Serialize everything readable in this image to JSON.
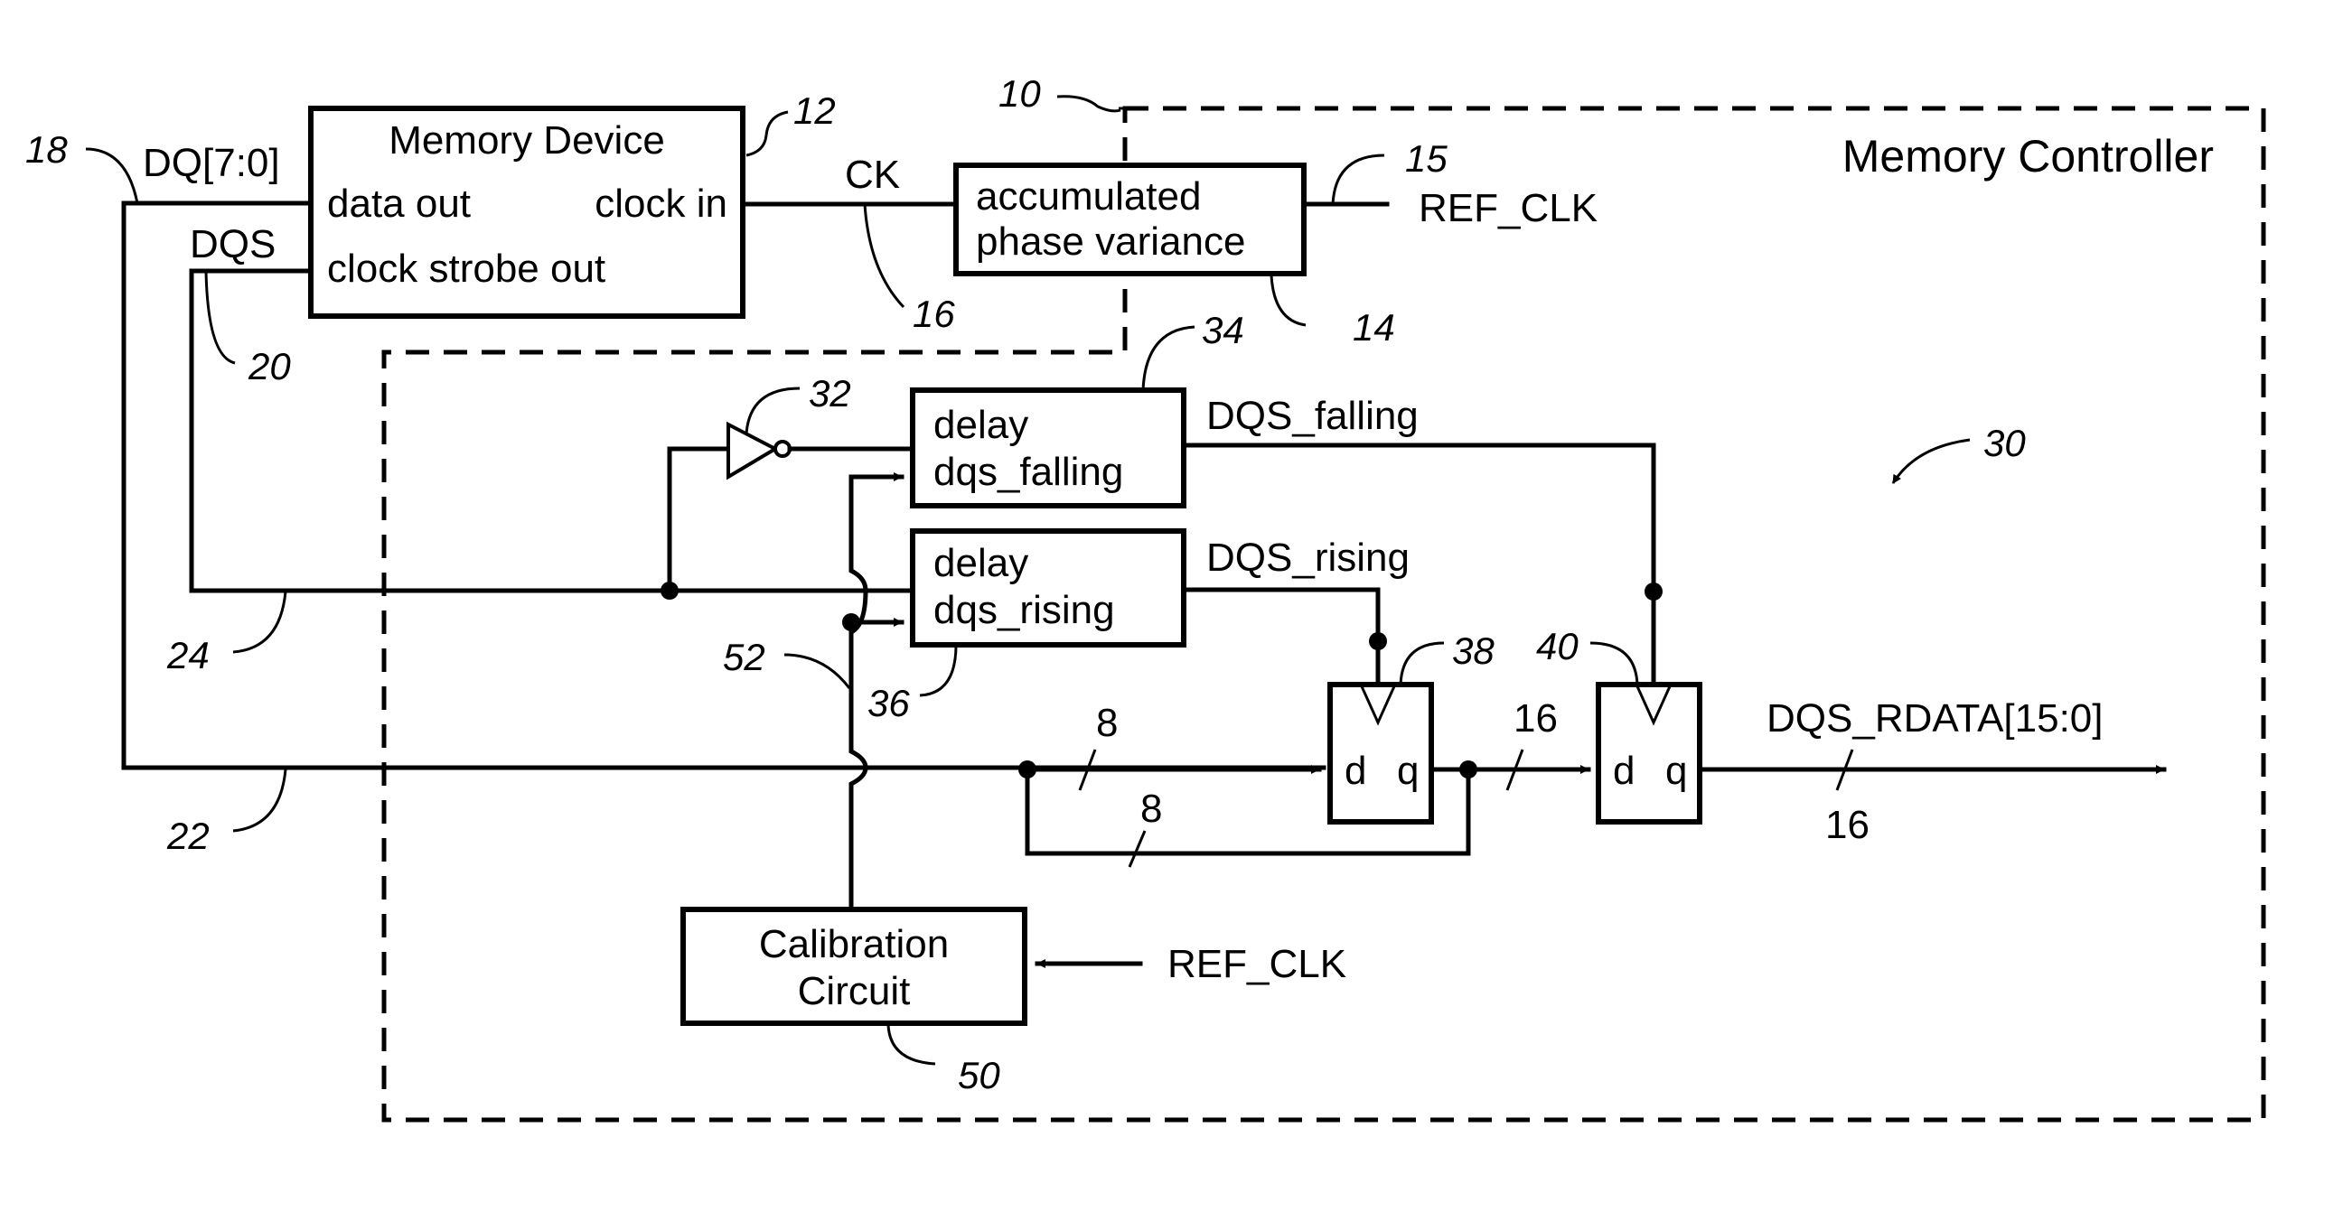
{
  "title": "Memory Controller",
  "blocks": {
    "memory_device": {
      "lines": [
        "Memory Device",
        "data out",
        "clock in",
        "clock strobe out"
      ]
    },
    "phase_variance": {
      "lines": [
        "accumulated",
        "phase variance"
      ]
    },
    "delay_falling": {
      "lines": [
        "delay",
        "dqs_falling"
      ]
    },
    "delay_rising": {
      "lines": [
        "delay",
        "dqs_rising"
      ]
    },
    "calibration": {
      "lines": [
        "Calibration",
        "Circuit"
      ]
    },
    "ff1": {
      "d": "d",
      "q": "q"
    },
    "ff2": {
      "d": "d",
      "q": "q"
    }
  },
  "signals": {
    "dq": "DQ[7:0]",
    "dqs": "DQS",
    "ck": "CK",
    "ref_clk_top": "REF_CLK",
    "ref_clk_cal": "REF_CLK",
    "dqs_falling": "DQS_falling",
    "dqs_rising": "DQS_rising",
    "rdata": "DQS_RDATA[15:0]"
  },
  "bus_widths": {
    "in_data": "8",
    "feedback": "8",
    "mid": "16",
    "out": "16"
  },
  "refs": {
    "r10": "10",
    "r12": "12",
    "r14": "14",
    "r15": "15",
    "r16": "16",
    "r18": "18",
    "r20": "20",
    "r22": "22",
    "r24": "24",
    "r30": "30",
    "r32": "32",
    "r34": "34",
    "r36": "36",
    "r38": "38",
    "r40": "40",
    "r50": "50",
    "r52": "52"
  }
}
